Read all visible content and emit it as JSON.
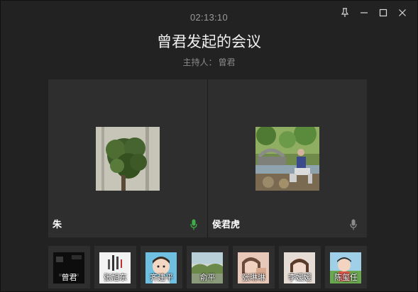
{
  "meeting": {
    "timer": "02:13:10",
    "title": "曾君发起的会议",
    "host_label": "主持人：",
    "host_name": "曾君"
  },
  "window_controls": [
    "pin-icon",
    "minimize-icon",
    "maximize-icon",
    "close-icon"
  ],
  "stage": {
    "tiles": [
      {
        "name": "朱",
        "mic": "mic-active-icon",
        "mic_color": "#3fae49"
      },
      {
        "name": "侯君虎",
        "mic": "mic-muted-icon",
        "mic_color": "#8a8a8a"
      }
    ]
  },
  "participants": [
    {
      "name": "曾君"
    },
    {
      "name": "张旭东"
    },
    {
      "name": "齐建平"
    },
    {
      "name": "俞平"
    },
    {
      "name": "张琳琳"
    },
    {
      "name": "李媛媛"
    },
    {
      "name": "陈玺任"
    }
  ],
  "colors": {
    "background": "#222222",
    "tile": "#2e2e2e",
    "mic_active": "#3fae49"
  }
}
